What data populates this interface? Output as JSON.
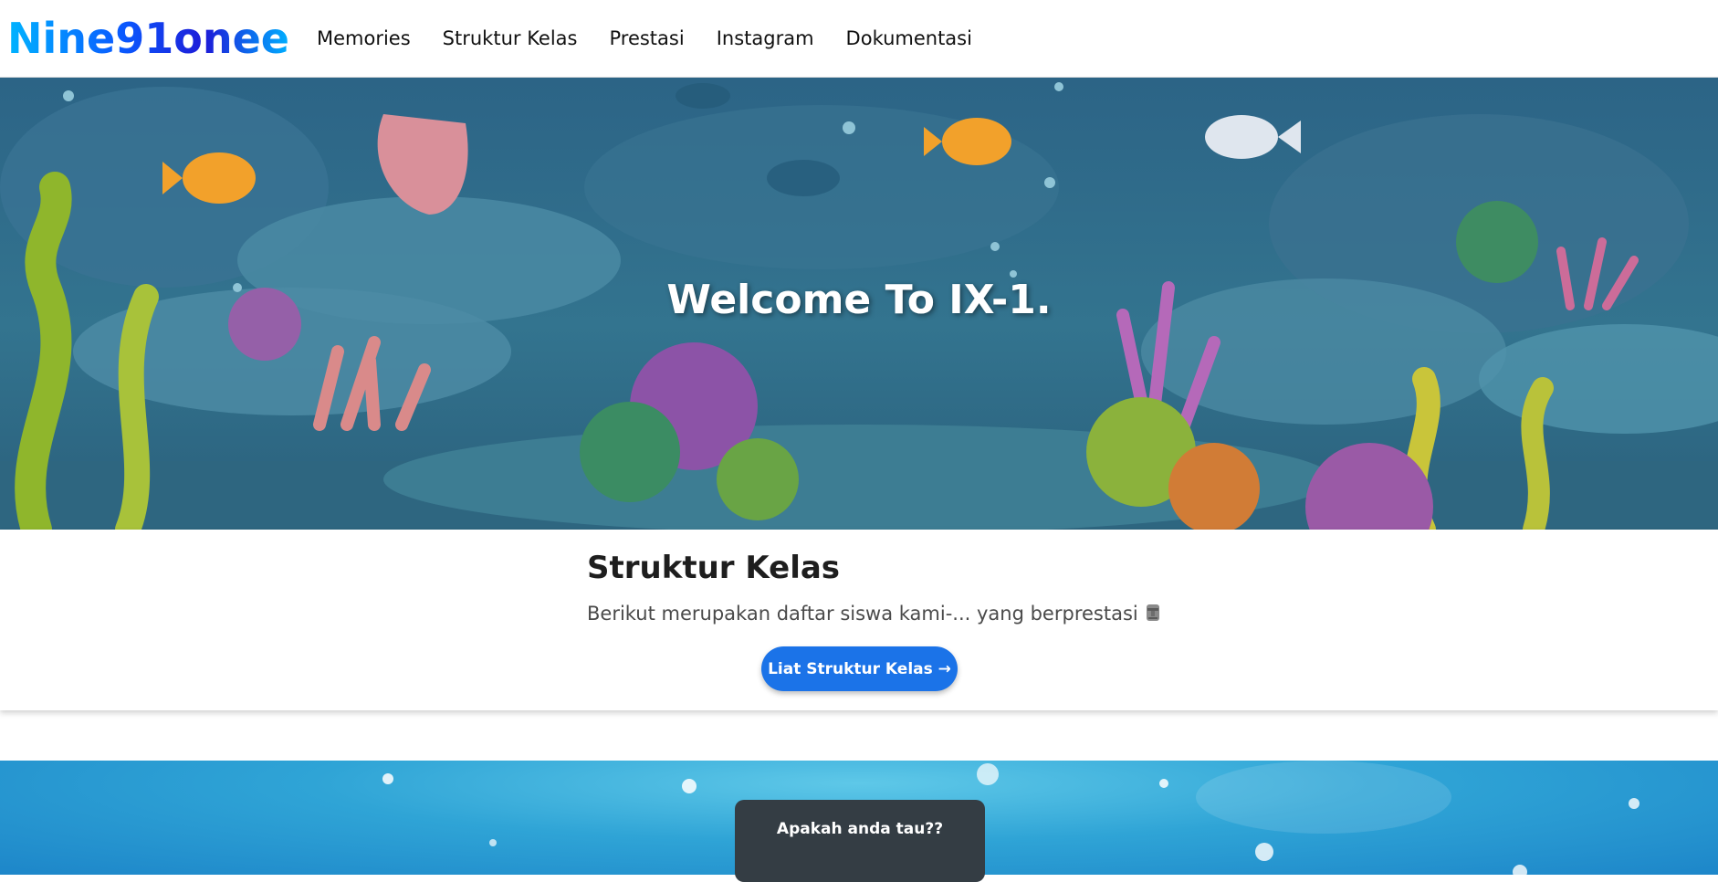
{
  "navbar": {
    "brand": "Nine91onee",
    "links": [
      "Memories",
      "Struktur Kelas",
      "Prestasi",
      "Instagram",
      "Dokumentasi"
    ]
  },
  "hero": {
    "title": "Welcome To IX-1."
  },
  "struktur": {
    "title": "Struktur Kelas",
    "description": "Berikut merupakan daftar siswa kami-... yang berprestasi",
    "button_label": "Liat Struktur Kelas →"
  },
  "fact_card": {
    "title": "Apakah anda tau??"
  },
  "colors": {
    "accent": "#1b73e8",
    "hero_bg": "#2d6c8c",
    "tooltip_bg": "#343d44"
  }
}
